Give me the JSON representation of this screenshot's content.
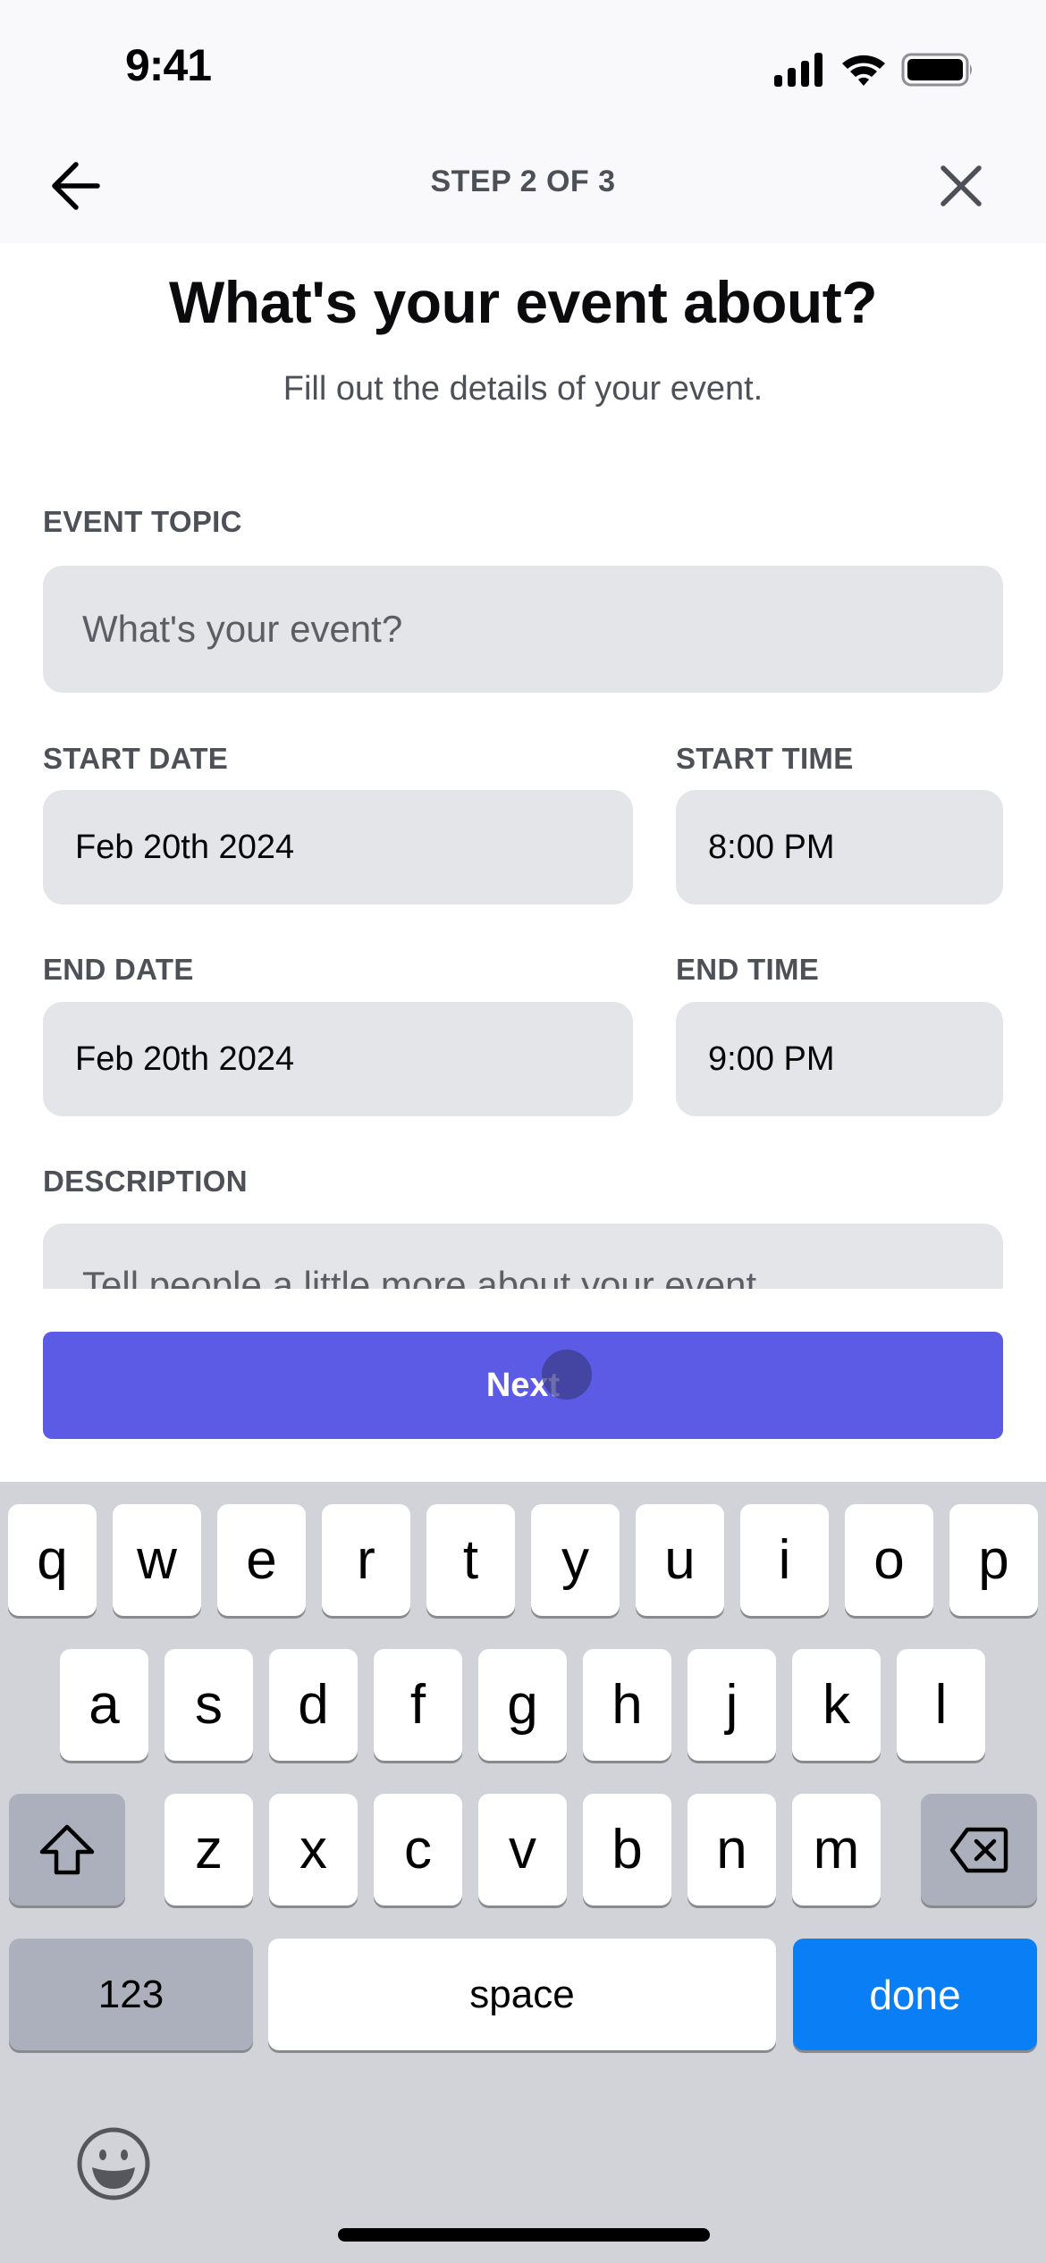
{
  "status_bar": {
    "time": "9:41",
    "icons": [
      "cellular-signal-icon",
      "wifi-icon",
      "battery-icon"
    ]
  },
  "nav": {
    "title": "STEP 2 OF 3",
    "back_icon": "arrow-left-icon",
    "close_icon": "close-icon"
  },
  "page": {
    "heading": "What's your event about?",
    "subheading": "Fill out the details of your event."
  },
  "form": {
    "event_topic": {
      "label": "EVENT TOPIC",
      "value": "",
      "placeholder": "What's your event?"
    },
    "start_date": {
      "label": "START DATE",
      "value": "Feb 20th 2024"
    },
    "start_time": {
      "label": "START TIME",
      "value": "8:00 PM"
    },
    "end_date": {
      "label": "END DATE",
      "value": "Feb 20th 2024"
    },
    "end_time": {
      "label": "END TIME",
      "value": "9:00 PM"
    },
    "description": {
      "label": "DESCRIPTION",
      "value": "",
      "placeholder": "Tell people a little more about your event."
    }
  },
  "actions": {
    "next_label": "Next",
    "next_color": "#5b5be6"
  },
  "keyboard": {
    "row1": [
      "q",
      "w",
      "e",
      "r",
      "t",
      "y",
      "u",
      "i",
      "o",
      "p"
    ],
    "row2": [
      "a",
      "s",
      "d",
      "f",
      "g",
      "h",
      "j",
      "k",
      "l"
    ],
    "row3": [
      "z",
      "x",
      "c",
      "v",
      "b",
      "n",
      "m"
    ],
    "shift_icon": "shift-icon",
    "delete_icon": "backspace-icon",
    "numbers_label": "123",
    "space_label": "space",
    "return_label": "done",
    "return_color": "#0a7ff5",
    "emoji_icon": "emoji-icon"
  }
}
